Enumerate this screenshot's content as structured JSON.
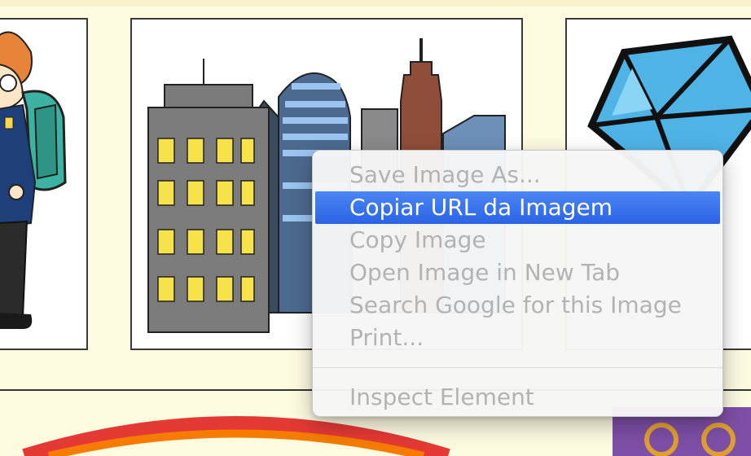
{
  "context_menu": {
    "items": [
      {
        "label": "Save Image As...",
        "enabled": false,
        "selected": false
      },
      {
        "label": "Copiar URL da Imagem",
        "enabled": true,
        "selected": true
      },
      {
        "label": "Copy Image",
        "enabled": false,
        "selected": false
      },
      {
        "label": "Open Image in New Tab",
        "enabled": false,
        "selected": false
      },
      {
        "label": "Search Google for this Image",
        "enabled": false,
        "selected": false
      },
      {
        "label": "Print...",
        "enabled": false,
        "selected": false
      }
    ],
    "after_separator": [
      {
        "label": "Inspect Element",
        "enabled": false,
        "selected": false
      }
    ],
    "highlight_color": "#3b74ee"
  },
  "colors": {
    "page_background": "#fdfbe0",
    "window_yellow": "#f7e24a",
    "gem_blue": "#4fb3e6"
  },
  "icons": {
    "left_card": "student-with-backpack-illustration",
    "center_card": "city-buildings-illustration",
    "right_card": "blue-gem-illustration"
  }
}
